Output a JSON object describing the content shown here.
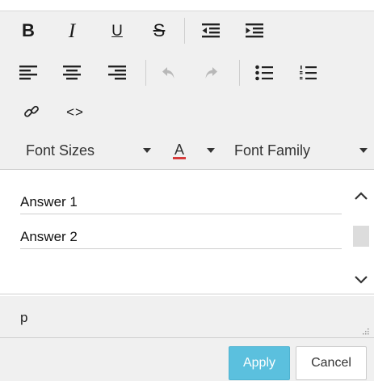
{
  "toolbar": {
    "row1": {
      "bold": "B",
      "italic": "I",
      "underline": "U",
      "strikethrough": "S",
      "outdent_icon": "outdent-icon",
      "indent_icon": "indent-icon"
    },
    "row2": {
      "align_left_icon": "align-left-icon",
      "align_center_icon": "align-center-icon",
      "align_right_icon": "align-right-icon",
      "undo_icon": "undo-icon",
      "redo_icon": "redo-icon",
      "bullet_list_icon": "bulleted-list-icon",
      "numbered_list_icon": "numbered-list-icon"
    },
    "row3": {
      "link_icon": "link-icon",
      "code": "<>"
    },
    "row4": {
      "font_sizes": "Font Sizes",
      "font_color": "A",
      "font_family": "Font Family"
    }
  },
  "content": {
    "answers": [
      "Answer 1",
      "Answer 2"
    ]
  },
  "status": {
    "element_path": "p"
  },
  "footer": {
    "apply_label": "Apply",
    "cancel_label": "Cancel"
  },
  "colors": {
    "toolbar_bg": "#f0f0f0",
    "apply_bg": "#5bc0de",
    "font_color_underline": "#d63b3b",
    "disabled_icon": "#b8b8b8"
  }
}
